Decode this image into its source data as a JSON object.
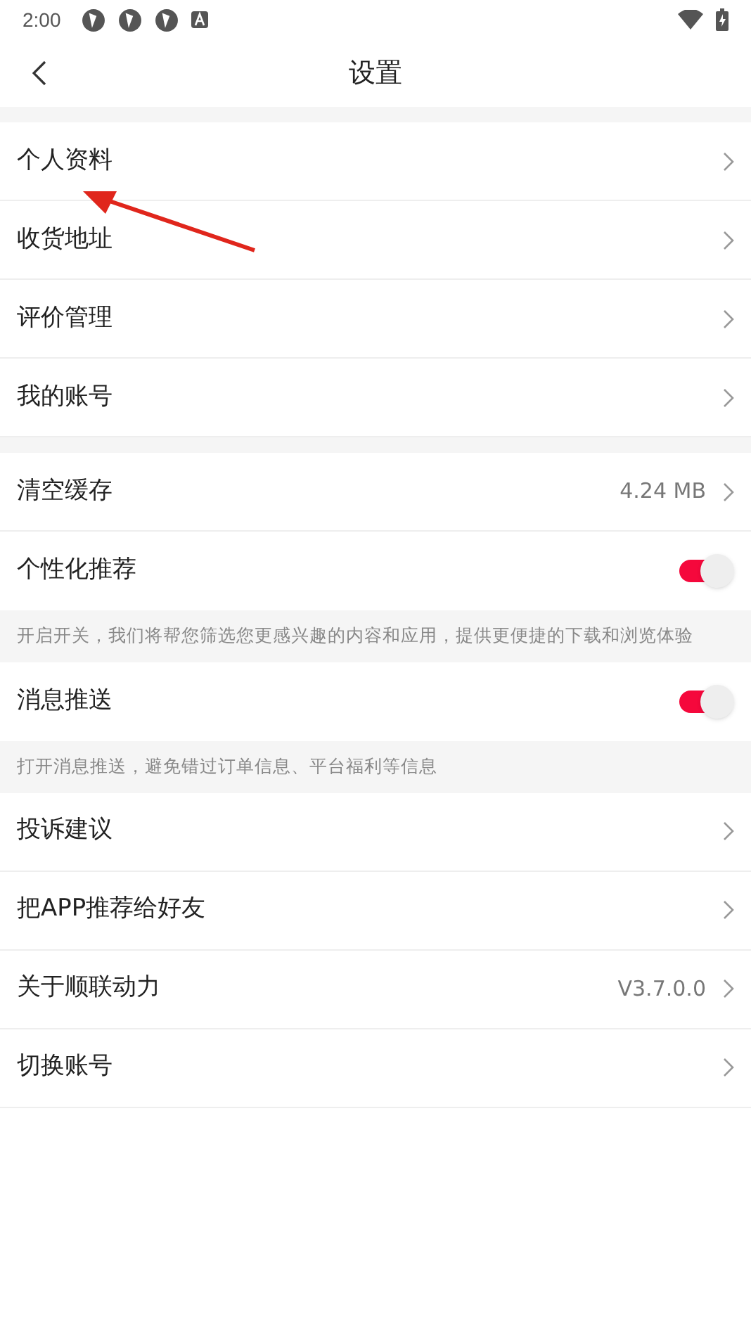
{
  "status_bar": {
    "time": "2:00"
  },
  "header": {
    "title": "设置"
  },
  "sections": [
    {
      "items": [
        {
          "kind": "link",
          "label": "个人资料"
        },
        {
          "kind": "link",
          "label": "收货地址"
        },
        {
          "kind": "link",
          "label": "评价管理"
        },
        {
          "kind": "link",
          "label": "我的账号"
        }
      ]
    },
    {
      "items": [
        {
          "kind": "link",
          "label": "清空缓存",
          "value": "4.24 MB"
        },
        {
          "kind": "toggle",
          "label": "个性化推荐",
          "on": true
        },
        {
          "kind": "note",
          "label": "开启开关，我们将帮您筛选您更感兴趣的内容和应用，提供更便捷的下载和浏览体验"
        },
        {
          "kind": "toggle",
          "label": "消息推送",
          "on": true
        },
        {
          "kind": "note",
          "label": "打开消息推送，避免错过订单信息、平台福利等信息"
        },
        {
          "kind": "link",
          "label": "投诉建议"
        },
        {
          "kind": "link",
          "label": "把APP推荐给好友"
        },
        {
          "kind": "link",
          "label": "关于顺联动力",
          "value": "V3.7.0.0"
        },
        {
          "kind": "link",
          "label": "切换账号"
        }
      ]
    }
  ]
}
